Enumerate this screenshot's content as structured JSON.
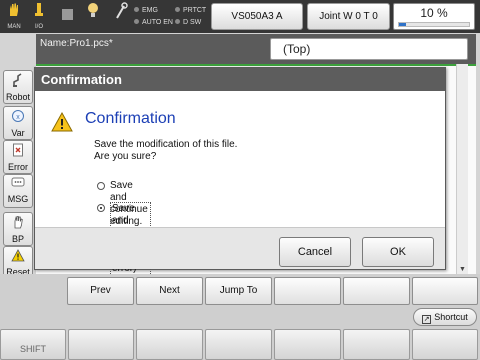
{
  "topbar": {
    "man_label": "MAN",
    "io_label": "I/O",
    "leds": [
      {
        "label": "EMG",
        "name": "emg-indicator"
      },
      {
        "label": "PRTCT",
        "name": "prtct-indicator"
      },
      {
        "label": "AUTO EN",
        "name": "auto-en-indicator"
      },
      {
        "label": "D SW",
        "name": "d-sw-indicator"
      }
    ],
    "robot_type": "VS050A3 A",
    "joint_mode": "Joint  W 0 T 0",
    "speed_label": "10 %",
    "speed_fraction": 0.1
  },
  "sidebar": {
    "items": [
      {
        "label": "Robot",
        "icon": "robot-icon"
      },
      {
        "label": "Var",
        "icon": "variable-icon"
      },
      {
        "label": "Error",
        "icon": "error-log-icon"
      },
      {
        "label": "MSG",
        "icon": "message-icon"
      },
      {
        "label": "BP",
        "icon": "hand-icon"
      },
      {
        "label": "Reset",
        "icon": "warning-icon"
      }
    ]
  },
  "editor": {
    "file_name": "Name:Pro1.pcs*",
    "procedure": "(Top)"
  },
  "dialog": {
    "title": "Confirmation",
    "heading": "Confirmation",
    "message": "Save the modification of this file.\nAre you sure?",
    "options": [
      {
        "label": "Save and continue editing.",
        "checked": false
      },
      {
        "label": "Save and close.\n(Without syntax error)",
        "checked": true
      }
    ],
    "cancel_label": "Cancel",
    "ok_label": "OK"
  },
  "function_keys": {
    "prev": "Prev",
    "next": "Next",
    "jump_to": "Jump To",
    "shortcut": "Shortcut",
    "shift": "SHIFT"
  },
  "colors": {
    "topbar_bg": "#363636",
    "title_bar_bg": "#5d5d5d",
    "heading_blue": "#1c3fb5",
    "progress_blue": "#2f72c8"
  }
}
